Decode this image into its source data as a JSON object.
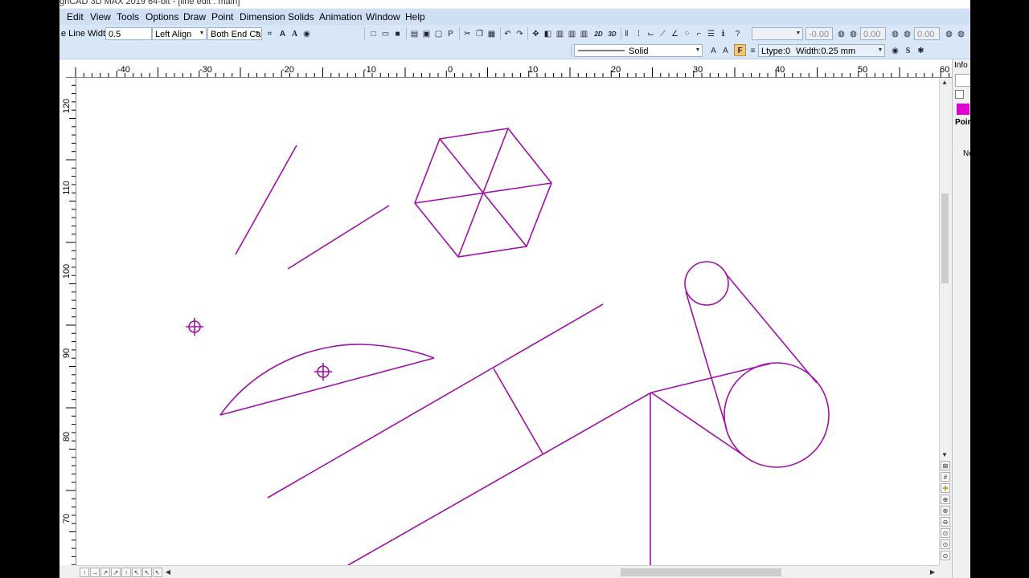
{
  "window": {
    "title": "ghCAD 3D MAX 2019 64-bit - [line edit : main]"
  },
  "menu": [
    "Edit",
    "View",
    "Tools",
    "Options",
    "Draw",
    "Point",
    "Dimension",
    "Solids",
    "Animation",
    "Window",
    "Help"
  ],
  "toolbar1": {
    "line_width_label": "e Line Width:",
    "line_width_value": "0.5",
    "align_value": "Left Align",
    "end_value": "Both End Ca",
    "mode_2d": "2D",
    "mode_3d": "3D",
    "field_x": "-0.00",
    "field_y": "0.00",
    "field_z": "0.00"
  },
  "toolbar2": {
    "line_style": "Solid",
    "ltype_label": "Ltype:0",
    "width_label": "Width:0.25 mm",
    "font_a1": "A",
    "font_a2": "A",
    "f_button": "F",
    "s_button": "S"
  },
  "ruler_top": [
    "-40",
    "-30",
    "-20",
    "-10",
    "0",
    "10",
    "20",
    "30",
    "40",
    "50",
    "60"
  ],
  "ruler_left": [
    "120",
    "110",
    "100",
    "90",
    "80",
    "70"
  ],
  "right_panel": {
    "tab": "Info",
    "point_label": "Poin",
    "status": "No",
    "color": "#e000d0"
  },
  "drawing_color": "#a010a8"
}
